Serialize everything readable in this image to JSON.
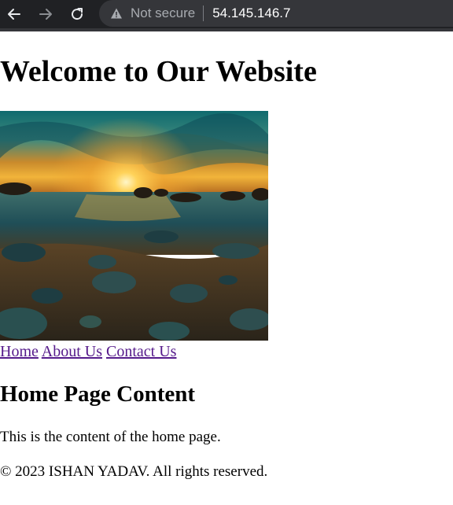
{
  "browser": {
    "security_label": "Not secure",
    "url": "54.145.146.7",
    "icons": {
      "back": "back-arrow-icon",
      "forward": "forward-arrow-icon",
      "reload": "reload-icon",
      "warning": "warning-triangle-icon"
    }
  },
  "page": {
    "title": "Welcome to Our Website",
    "nav": [
      "Home",
      "About Us",
      "Contact Us"
    ],
    "section_title": "Home Page Content",
    "body": "This is the content of the home page.",
    "footer": "© 2023 ISHAN YADAV. All rights reserved."
  },
  "colors": {
    "browser_bar": "#202124",
    "omnibox": "#35363a",
    "visited_link": "#551a8b"
  }
}
